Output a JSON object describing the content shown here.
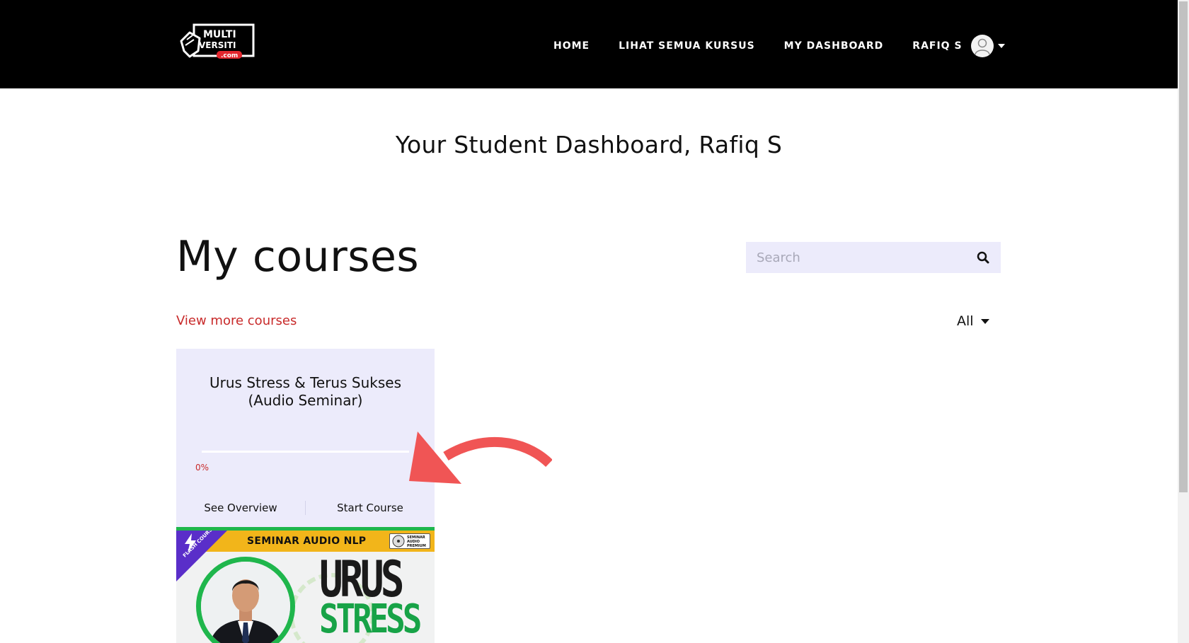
{
  "brand": {
    "logo_text_1": "MULTI",
    "logo_text_2": "VERSITI",
    "logo_text_3": ".com",
    "colors": {
      "topbar": "#000000",
      "accent": "#c82a2a",
      "card_bg": "#ecebfb",
      "green": "#1fb64c"
    }
  },
  "nav": {
    "items": [
      "HOME",
      "LIHAT SEMUA KURSUS",
      "MY DASHBOARD"
    ],
    "user_name": "RAFIQ S",
    "avatar_icon": "user-avatar-icon"
  },
  "page": {
    "welcome": "Your Student Dashboard, Rafiq S",
    "heading": "My courses",
    "view_more": "View more courses",
    "filter_selected": "All"
  },
  "search": {
    "placeholder": "Search",
    "value": "",
    "icon": "search-icon"
  },
  "course": {
    "title": "Urus Stress & Terus Sukses (Audio Seminar)",
    "progress_label": "0%",
    "progress_fraction": 0,
    "actions": {
      "overview": "See Overview",
      "start": "Start Course"
    },
    "thumbnail": {
      "banner": "SEMINAR AUDIO NLP",
      "ribbon": "FLASH COURSE",
      "badge": "SEMINAR AUDIO PREMIUM",
      "line1": "URUS",
      "line2": "STRESS"
    }
  },
  "annotation": {
    "arrow_color": "#f05555",
    "arrow_icon": "curved-arrow-icon"
  }
}
